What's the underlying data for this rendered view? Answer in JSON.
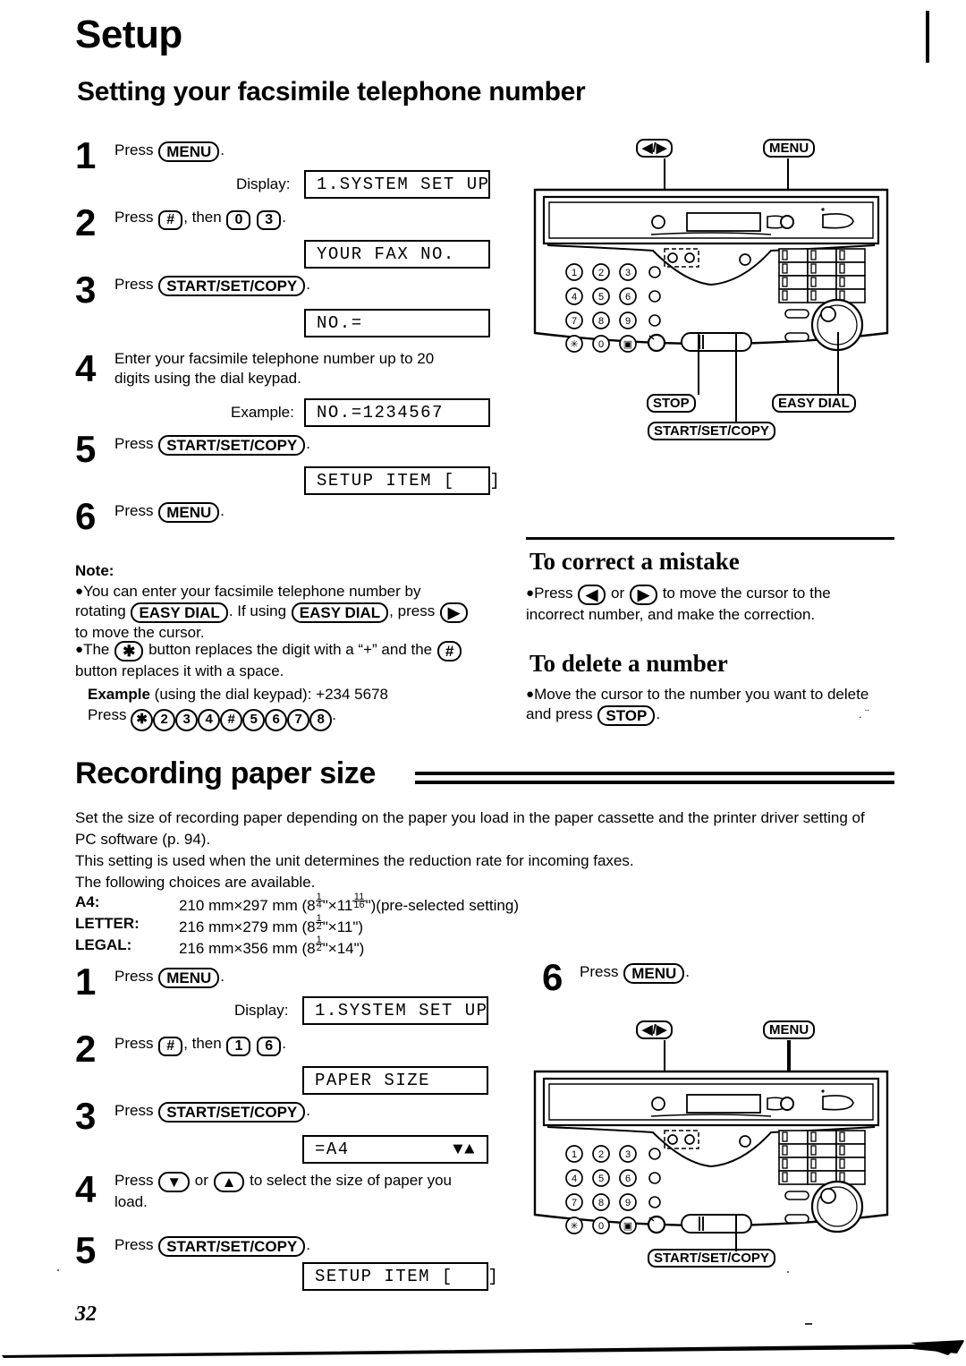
{
  "page": {
    "title": "Setup",
    "number": "32"
  },
  "section1": {
    "heading": "Setting your facsimile telephone number",
    "steps": [
      {
        "num": "1",
        "text_before": "Press ",
        "button": "MENU",
        "text_after": ".",
        "display_label": "Display:",
        "display_value": "1.SYSTEM SET UP"
      },
      {
        "num": "2",
        "text_before": "Press ",
        "key1": "#",
        "text_mid": ", then ",
        "key2": "0",
        "key3": "3",
        "text_after": ".",
        "display_value": "YOUR FAX NO."
      },
      {
        "num": "3",
        "text_before": "Press ",
        "button": "START/SET/COPY",
        "text_after": ".",
        "display_value": "NO.="
      },
      {
        "num": "4",
        "text": "Enter your facsimile telephone number up to 20 digits using the dial keypad.",
        "display_label": "Example:",
        "display_value": "NO.=1234567"
      },
      {
        "num": "5",
        "text_before": "Press ",
        "button": "START/SET/COPY",
        "text_after": ".",
        "display_value": "SETUP ITEM [   ]"
      },
      {
        "num": "6",
        "text_before": "Press ",
        "button": "MENU",
        "text_after": "."
      }
    ],
    "note": {
      "heading": "Note:",
      "item1_a": "You can enter your facsimile telephone number by rotating ",
      "item1_btn1": "EASY DIAL",
      "item1_b": ". If using ",
      "item1_btn2": "EASY DIAL",
      "item1_c": ", press ",
      "item1_btn3": "▶",
      "item1_d": " to move the cursor.",
      "item2_a": "The ",
      "item2_btn1": "✱",
      "item2_b": " button replaces the digit with a “+” and the ",
      "item2_btn2": "#",
      "item2_c": " button replaces it with a space.",
      "example_label": "Example",
      "example_text": " (using the dial keypad):  +234  5678",
      "press_label": "Press ",
      "press_keys": [
        "✱",
        "2",
        "3",
        "4",
        "#",
        "5",
        "6",
        "7",
        "8"
      ],
      "press_period": "."
    }
  },
  "right_column": {
    "correct": {
      "heading": "To correct a mistake",
      "text_a": "Press ",
      "btn_left": "◀",
      "text_b": " or ",
      "btn_right": "▶",
      "text_c": " to move the cursor to the incorrect number, and make the correction."
    },
    "delete": {
      "heading": "To delete a number",
      "text_a": "Move the cursor to the number you want to delete and press ",
      "btn_stop": "STOP",
      "text_b": "."
    }
  },
  "section2": {
    "heading": "Recording paper size",
    "paragraphs": [
      "Set the size of recording paper depending on the paper you load in the paper cassette and the printer driver setting of PC software (p. 94).",
      "This setting is used when the unit determines the reduction rate for incoming faxes.",
      "The following choices are available."
    ],
    "sizes": [
      {
        "label": "A4:",
        "metric": "210 mm×297 mm",
        "imperial_pre": "(8",
        "f1n": "1",
        "f1d": "4",
        "imperial_mid": "\"×11",
        "f2n": "11",
        "f2d": "16",
        "imperial_post": "\")(pre-selected setting)"
      },
      {
        "label": "LETTER:",
        "metric": "216 mm×279 mm",
        "imperial_pre": "(8",
        "f1n": "1",
        "f1d": "2",
        "imperial_mid": "\"×11",
        "f2n": "",
        "f2d": "",
        "imperial_post": "\")"
      },
      {
        "label": "LEGAL:",
        "metric": "216 mm×356 mm",
        "imperial_pre": "(8",
        "f1n": "1",
        "f1d": "2",
        "imperial_mid": "\"×14",
        "f2n": "",
        "f2d": "",
        "imperial_post": "\")"
      }
    ],
    "steps": [
      {
        "num": "1",
        "text_before": "Press ",
        "button": "MENU",
        "text_after": ".",
        "display_label": "Display:",
        "display_value": "1.SYSTEM SET UP"
      },
      {
        "num": "2",
        "text_before": "Press ",
        "key1": "#",
        "text_mid": ", then ",
        "key2": "1",
        "key3": "6",
        "text_after": ".",
        "display_value": "PAPER SIZE"
      },
      {
        "num": "3",
        "text_before": "Press ",
        "button": "START/SET/COPY",
        "text_after": ".",
        "display_value": "=A4",
        "display_arrows": "▼▲"
      },
      {
        "num": "4",
        "text_a": "Press ",
        "btn_down": "▼",
        "text_b": " or ",
        "btn_up": "▲",
        "text_c": " to select the size of paper you load."
      },
      {
        "num": "5",
        "text_before": "Press ",
        "button": "START/SET/COPY",
        "text_after": ".",
        "display_value": "SETUP ITEM [   ]"
      },
      {
        "num": "6",
        "text_before": "Press ",
        "button": "MENU",
        "text_after": "."
      }
    ]
  },
  "diagram_top": {
    "label_arrows": "◀/▶",
    "label_menu": "MENU",
    "label_stop": "STOP",
    "label_easy_dial": "EASY DIAL",
    "label_start": "START/SET/COPY",
    "keypad": [
      "1",
      "2",
      "3",
      "4",
      "5",
      "6",
      "7",
      "8",
      "9",
      "✱",
      "0",
      "▣"
    ]
  },
  "diagram_bottom": {
    "label_arrows": "◀/▶",
    "label_menu": "MENU",
    "label_start": "START/SET/COPY",
    "keypad": [
      "1",
      "2",
      "3",
      "4",
      "5",
      "6",
      "7",
      "8",
      "9",
      "✱",
      "0",
      "▣"
    ]
  }
}
